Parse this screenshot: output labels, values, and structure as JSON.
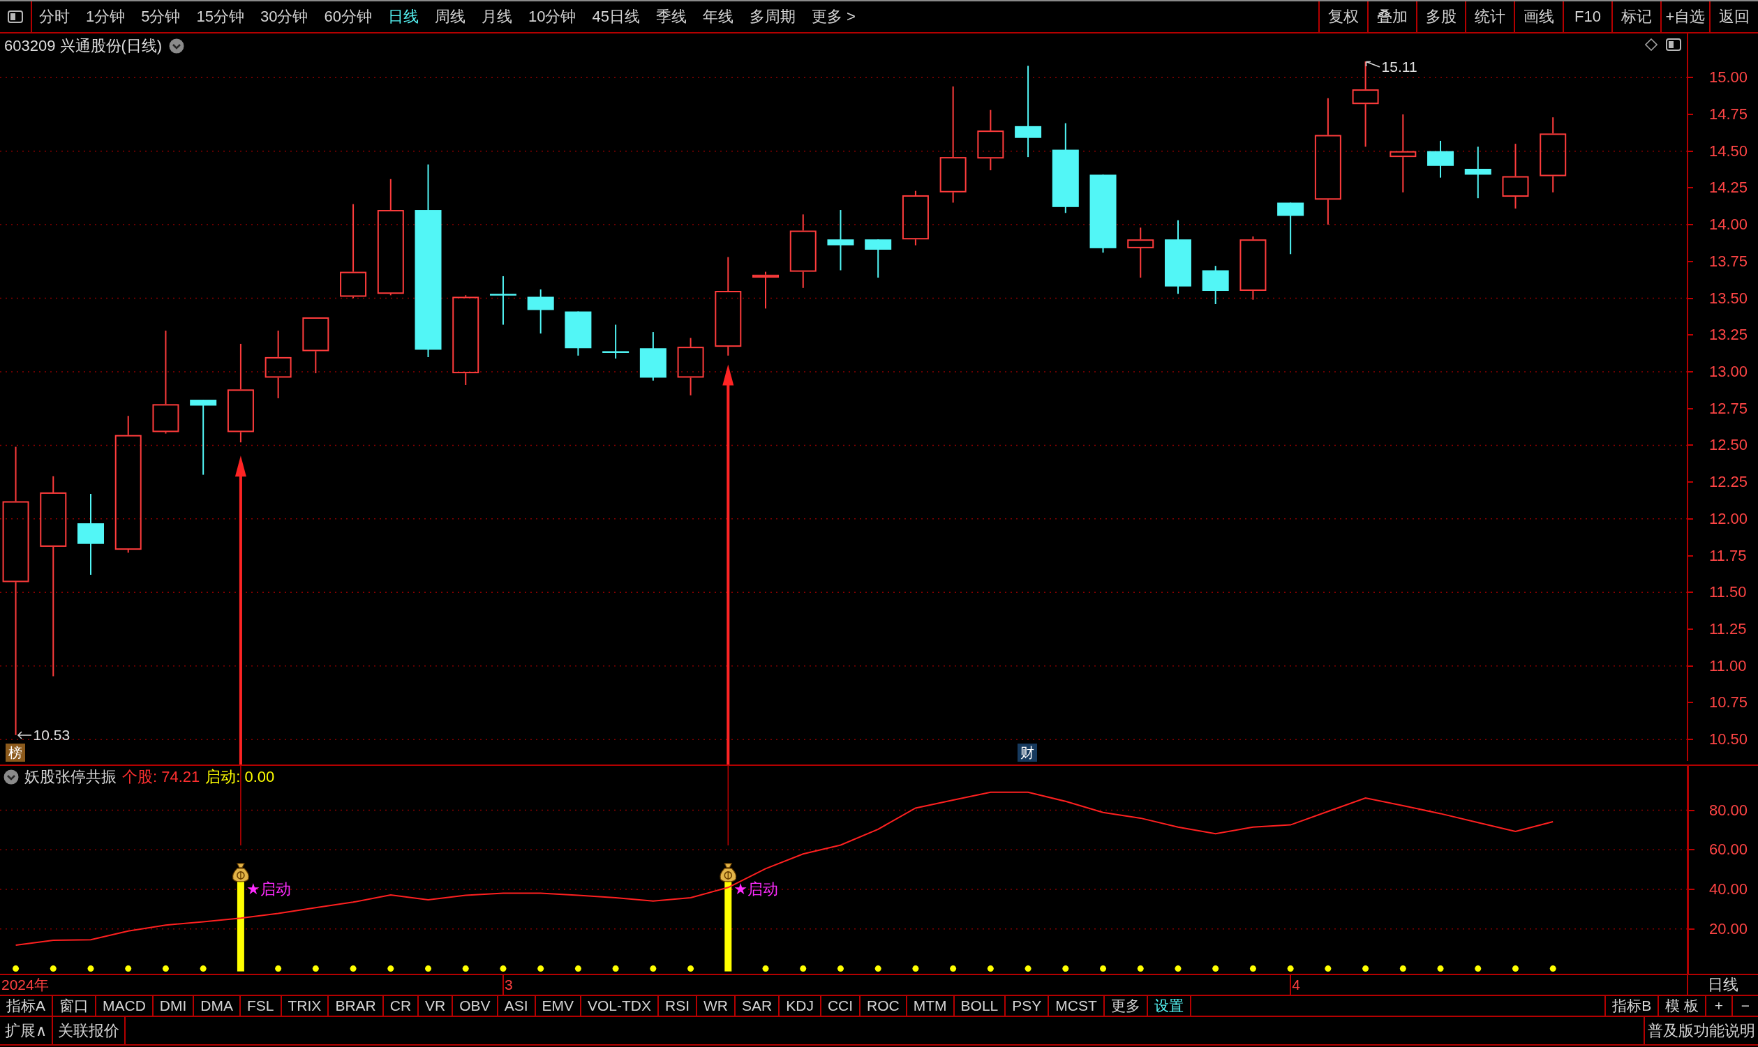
{
  "toolbar": {
    "periods": [
      {
        "label": "分时",
        "selected": false
      },
      {
        "label": "1分钟",
        "selected": false
      },
      {
        "label": "5分钟",
        "selected": false
      },
      {
        "label": "15分钟",
        "selected": false
      },
      {
        "label": "30分钟",
        "selected": false
      },
      {
        "label": "60分钟",
        "selected": false
      },
      {
        "label": "日线",
        "selected": true
      },
      {
        "label": "周线",
        "selected": false
      },
      {
        "label": "月线",
        "selected": false
      },
      {
        "label": "10分钟",
        "selected": false
      },
      {
        "label": "45日线",
        "selected": false
      },
      {
        "label": "季线",
        "selected": false
      },
      {
        "label": "年线",
        "selected": false
      },
      {
        "label": "多周期",
        "selected": false
      },
      {
        "label": "更多 >",
        "selected": false
      }
    ],
    "actions": [
      "复权",
      "叠加",
      "多股",
      "统计",
      "画线",
      "F10",
      "标记",
      "+自选",
      "返回"
    ]
  },
  "price_chart": {
    "title": "603209 兴通股份(日线)",
    "price_axis": [
      "15.00",
      "14.75",
      "14.50",
      "14.25",
      "14.00",
      "13.75",
      "13.50",
      "13.25",
      "13.00",
      "12.75",
      "12.50",
      "12.25",
      "12.00",
      "11.75",
      "11.50",
      "11.25",
      "11.00",
      "10.75",
      "10.50"
    ],
    "high_label": "15.11",
    "low_label": "10.53",
    "tags": [
      {
        "text": "榜",
        "color": "#8c5a1c"
      },
      {
        "text": "财",
        "color": "#163a5e"
      }
    ]
  },
  "indicator": {
    "name": "妖股张停共振",
    "legend": [
      {
        "text": "个股: 74.21",
        "color": "#ff3030"
      },
      {
        "text": "启动: 0.00",
        "color": "#ffff00"
      }
    ],
    "chart_data": {
      "type": "line",
      "categories": [
        "2024年",
        null,
        null,
        null,
        null,
        null,
        null,
        null,
        null,
        null,
        null,
        null,
        null,
        "3",
        null,
        null,
        null,
        null,
        null,
        null,
        null,
        null,
        null,
        null,
        null,
        null,
        null,
        null,
        null,
        null,
        null,
        null,
        null,
        null,
        "4",
        null,
        null,
        null,
        null,
        null,
        null,
        null
      ],
      "ylim": [
        -2.6,
        102.4
      ],
      "grid": true,
      "yticks": [
        {
          "value": 80,
          "label": "80.00"
        },
        {
          "value": 60,
          "label": "60.00"
        },
        {
          "value": 40,
          "label": "40.00"
        },
        {
          "value": 20,
          "label": "20.00"
        }
      ],
      "series": [
        {
          "color": "#ff2020",
          "values": [
            11.8,
            14.3,
            14.6,
            19.0,
            22.0,
            23.6,
            25.5,
            27.9,
            30.8,
            33.6,
            37.2,
            34.8,
            37.0,
            38.1,
            38.1,
            37.0,
            35.8,
            34.1,
            35.8,
            41.0,
            50.5,
            57.9,
            62.4,
            70.4,
            81.1,
            85.1,
            89.1,
            89.1,
            84.5,
            78.9,
            76.0,
            71.5,
            68.1,
            71.5,
            72.6,
            79.4,
            86.2,
            82.3,
            78.3,
            73.8,
            69.3,
            74.2
          ]
        }
      ],
      "annotations": [
        "★启动",
        "★启动"
      ]
    }
  },
  "period_label": "日线",
  "indicator_tabs": {
    "left": [
      {
        "label": "指标A",
        "selected": false
      },
      {
        "label": "窗口",
        "selected": false
      },
      {
        "label": "MACD",
        "selected": false
      },
      {
        "label": "DMI",
        "selected": false
      },
      {
        "label": "DMA",
        "selected": false
      },
      {
        "label": "FSL",
        "selected": false
      },
      {
        "label": "TRIX",
        "selected": false
      },
      {
        "label": "BRAR",
        "selected": false
      },
      {
        "label": "CR",
        "selected": false
      },
      {
        "label": "VR",
        "selected": false
      },
      {
        "label": "OBV",
        "selected": false
      },
      {
        "label": "ASI",
        "selected": false
      },
      {
        "label": "EMV",
        "selected": false
      },
      {
        "label": "VOL-TDX",
        "selected": false
      },
      {
        "label": "RSI",
        "selected": false
      },
      {
        "label": "WR",
        "selected": false
      },
      {
        "label": "SAR",
        "selected": false
      },
      {
        "label": "KDJ",
        "selected": false
      },
      {
        "label": "CCI",
        "selected": false
      },
      {
        "label": "ROC",
        "selected": false
      },
      {
        "label": "MTM",
        "selected": false
      },
      {
        "label": "BOLL",
        "selected": false
      },
      {
        "label": "PSY",
        "selected": false
      },
      {
        "label": "MCST",
        "selected": false
      },
      {
        "label": "更多",
        "selected": false
      },
      {
        "label": "设置",
        "selected": true
      }
    ],
    "right": [
      "指标B",
      "模 板",
      "+",
      "−"
    ]
  },
  "status_bar": {
    "left": [
      "扩展∧",
      "关联报价"
    ],
    "right": [
      "普及版功能说明"
    ]
  }
}
